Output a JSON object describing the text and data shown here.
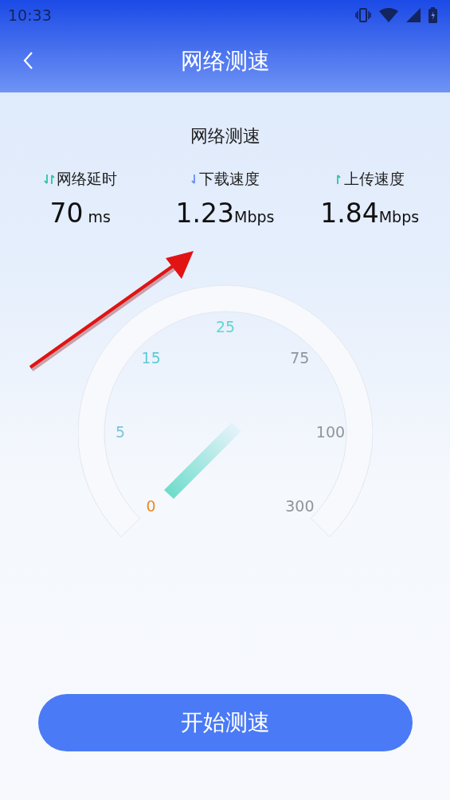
{
  "status_bar": {
    "time": "10:33"
  },
  "header": {
    "title": "网络测速"
  },
  "section_title": "网络测速",
  "stats": [
    {
      "kind": "updown",
      "label": "网络延时",
      "value": "70",
      "unit": "ms"
    },
    {
      "kind": "down",
      "label": "下载速度",
      "value": "1.23",
      "unit": "Mbps"
    },
    {
      "kind": "up",
      "label": "上传速度",
      "value": "1.84",
      "unit": "Mbps"
    }
  ],
  "gauge": {
    "ticks": [
      {
        "label": "0",
        "color": "#f08a24"
      },
      {
        "label": "5",
        "color": "#7ec4d8"
      },
      {
        "label": "15",
        "color": "#5ccbd8"
      },
      {
        "label": "25",
        "color": "#5fd6d0"
      },
      {
        "label": "75",
        "color": "#8f959c"
      },
      {
        "label": "100",
        "color": "#8f959c"
      },
      {
        "label": "300",
        "color": "#8f959c"
      }
    ]
  },
  "start_button": "开始测速"
}
